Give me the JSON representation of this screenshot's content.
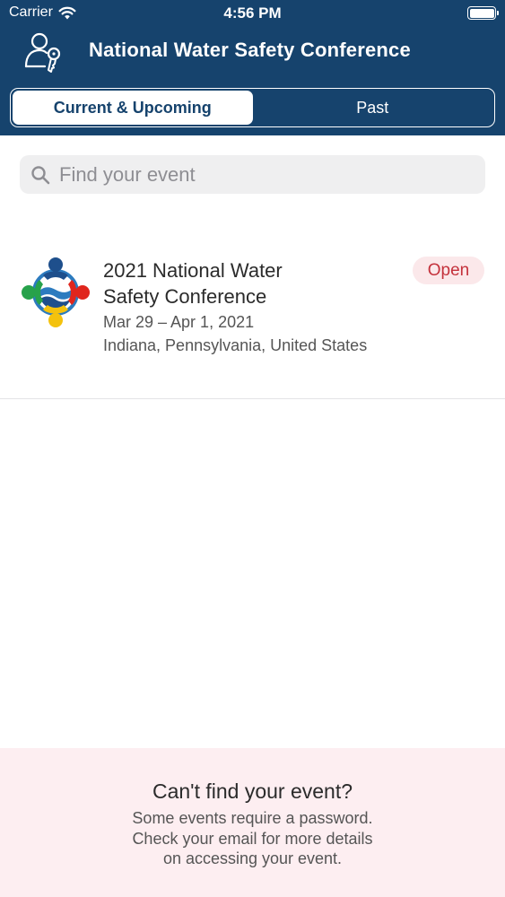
{
  "status_bar": {
    "carrier": "Carrier",
    "time": "4:56 PM",
    "wifi_icon": "wifi-icon",
    "battery_icon": "battery-icon"
  },
  "header": {
    "title": "National Water Safety Conference",
    "icon": "user-key-icon",
    "background_color": "#16436d"
  },
  "tabs": [
    {
      "label": "Current & Upcoming",
      "selected": true
    },
    {
      "label": "Past",
      "selected": false
    }
  ],
  "search": {
    "placeholder": "Find your event",
    "value": ""
  },
  "events": [
    {
      "title_line1": "2021 National Water",
      "title_line2": "Safety Conference",
      "dates": "Mar 29 – Apr 1, 2021",
      "location": "Indiana, Pennsylvania, United States",
      "status": "Open",
      "status_color": "#c4323c"
    }
  ],
  "footer": {
    "heading": "Can't find your event?",
    "line1": "Some events require a password.",
    "line2": "Check your email for more details",
    "line3": "on accessing your event."
  }
}
